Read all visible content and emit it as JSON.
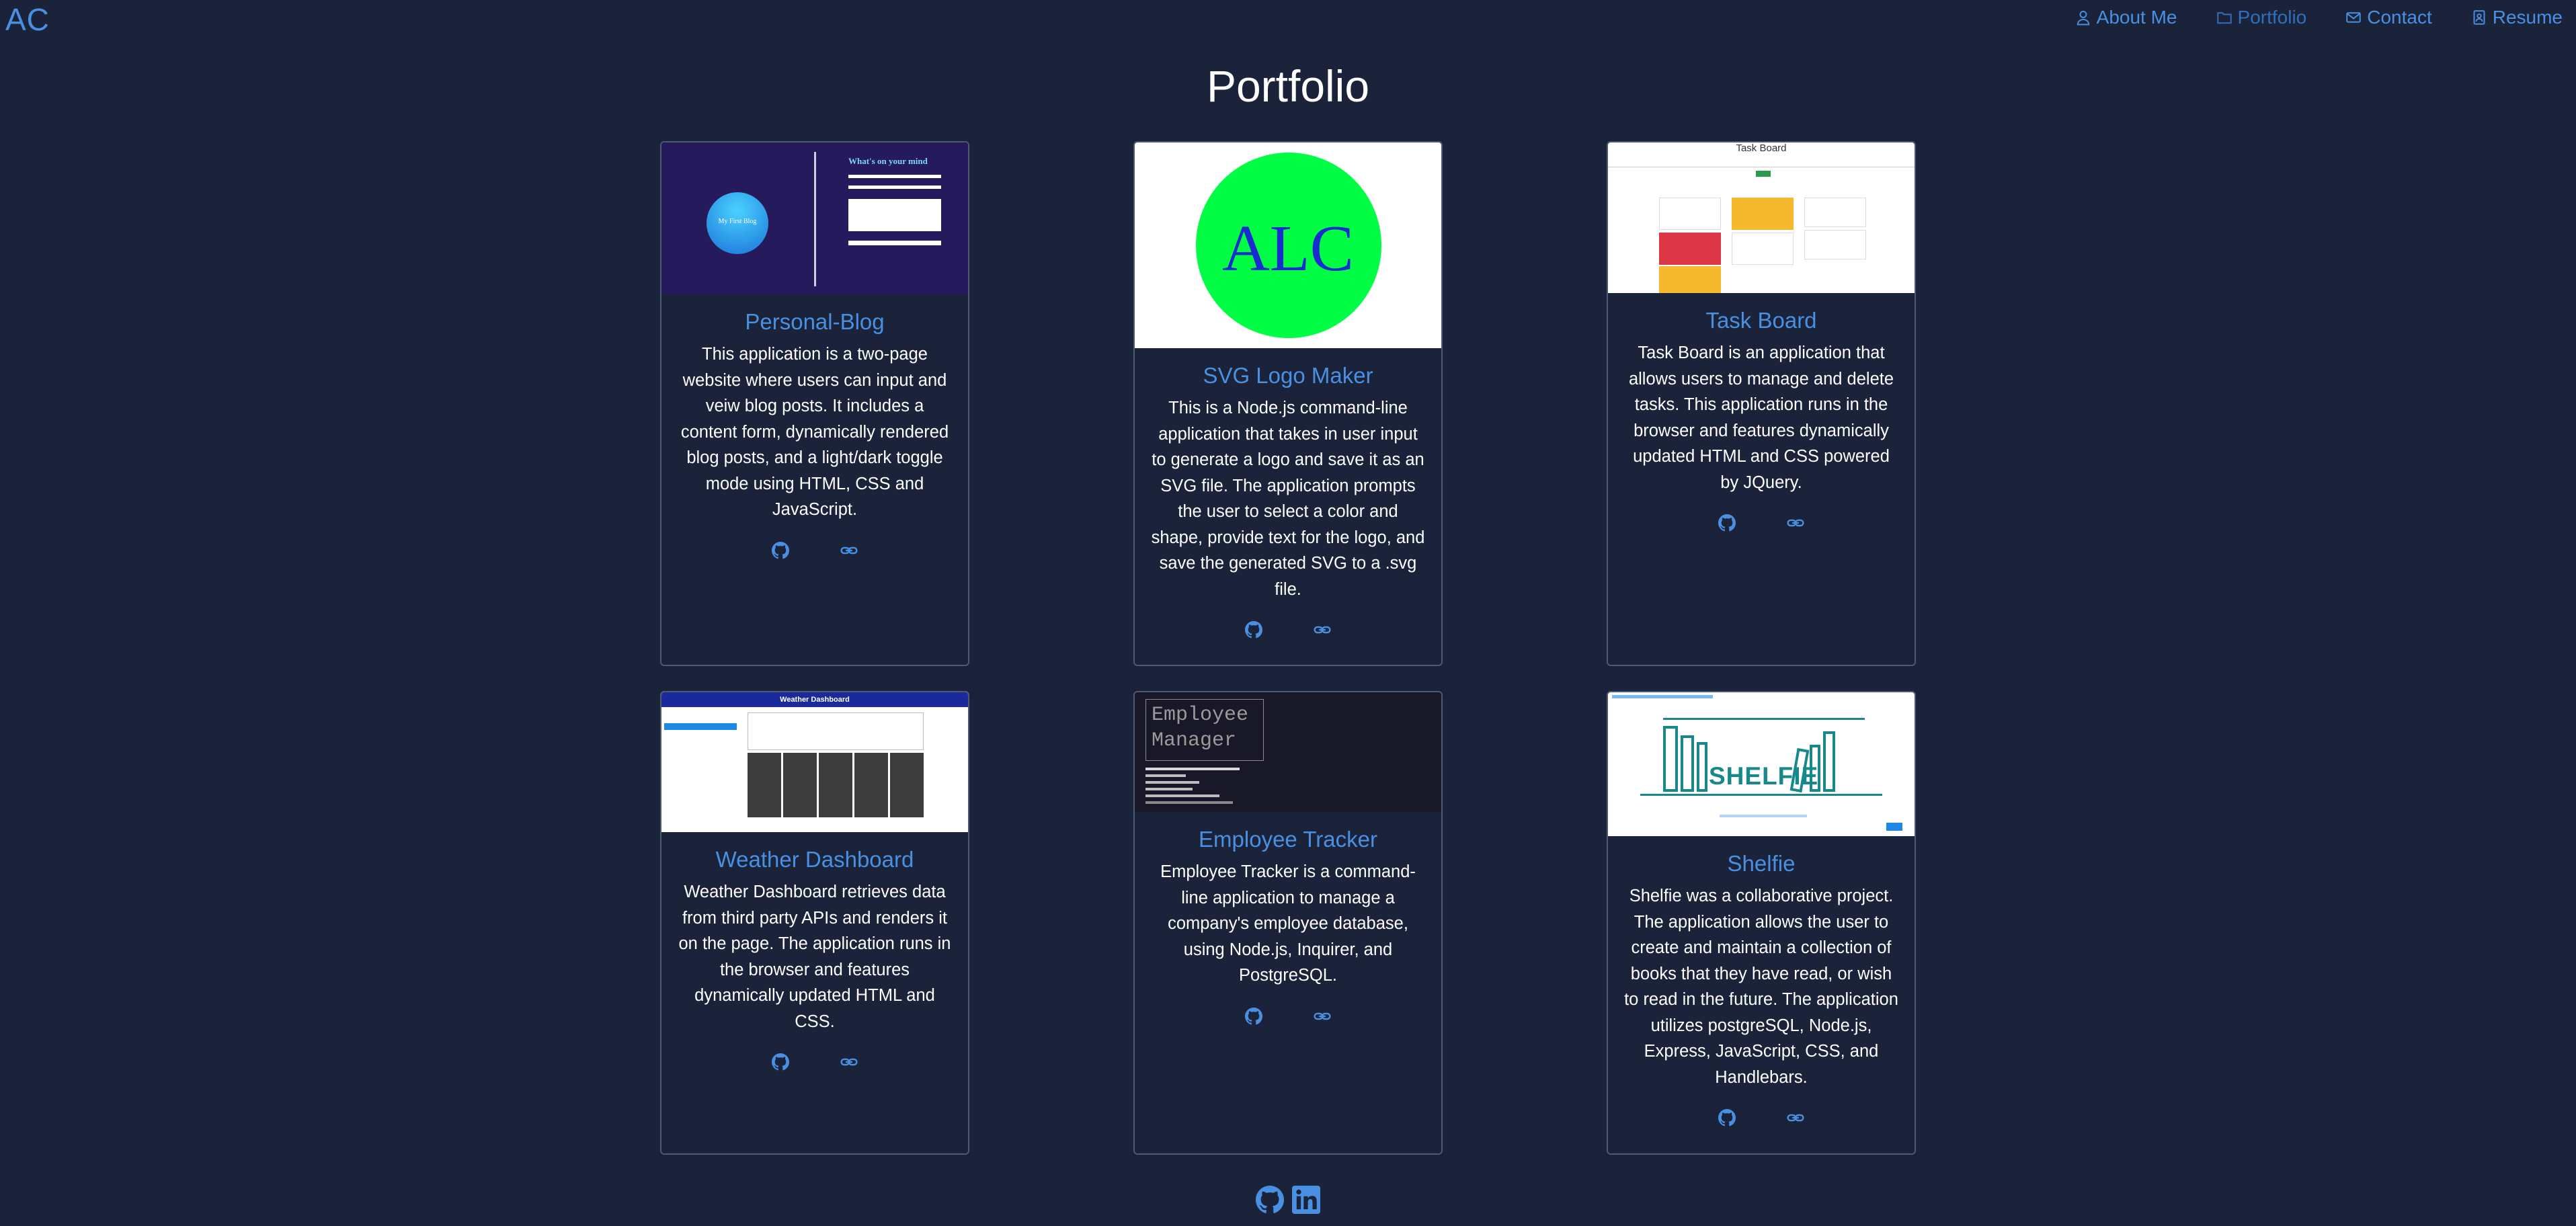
{
  "header": {
    "brand": "AC",
    "nav": [
      {
        "label": "About Me",
        "icon": "person-icon",
        "active": false
      },
      {
        "label": "Portfolio",
        "icon": "folder-icon",
        "active": true
      },
      {
        "label": "Contact",
        "icon": "envelope-icon",
        "active": false
      },
      {
        "label": "Resume",
        "icon": "file-person-icon",
        "active": false
      }
    ]
  },
  "page": {
    "title": "Portfolio"
  },
  "cards": [
    {
      "title": "Personal-Blog",
      "description": "This application is a two-page website where users can input and veiw blog posts. It includes a content form, dynamically rendered blog posts, and a light/dark toggle mode using HTML, CSS and JavaScript.",
      "thumb_text_1": "My First Blog",
      "thumb_text_2": "What's on your mind"
    },
    {
      "title": "SVG Logo Maker",
      "description": "This is a Node.js command-line application that takes in user input to generate a logo and save it as an SVG file. The application prompts the user to select a color and shape, provide text for the logo, and save the generated SVG to a .svg file.",
      "thumb_text_1": "ALC"
    },
    {
      "title": "Task Board",
      "description": "Task Board is an application that allows users to manage and delete tasks. This application runs in the browser and features dynamically updated HTML and CSS powered by JQuery.",
      "thumb_text_1": "Task Board"
    },
    {
      "title": "Weather Dashboard",
      "description": "Weather Dashboard retrieves data from third party APIs and renders it on the page. The application runs in the browser and features dynamically updated HTML and CSS.",
      "thumb_text_1": "Weather Dashboard"
    },
    {
      "title": "Employee Tracker",
      "description": "Employee Tracker is a command-line application to manage a company's employee database, using Node.js, Inquirer, and PostgreSQL.",
      "thumb_text_1": "Employee",
      "thumb_text_2": "Manager"
    },
    {
      "title": "Shelfie",
      "description": "Shelfie was a collaborative project. The application allows the user to create and maintain a collection of books that they have read, or wish to read in the future. The application utilizes postgreSQL, Node.js, Express, JavaScript, CSS, and Handlebars.",
      "thumb_text_1": "SHELFIE"
    }
  ],
  "card_links": {
    "github_icon": "github-icon",
    "link_icon": "link-icon"
  },
  "footer": {
    "icons": [
      "github-icon",
      "linkedin-icon"
    ]
  },
  "colors": {
    "background": "#1a233a",
    "accent": "#4a90e2",
    "text": "#ffffff",
    "card_border": "#4e5a73"
  }
}
